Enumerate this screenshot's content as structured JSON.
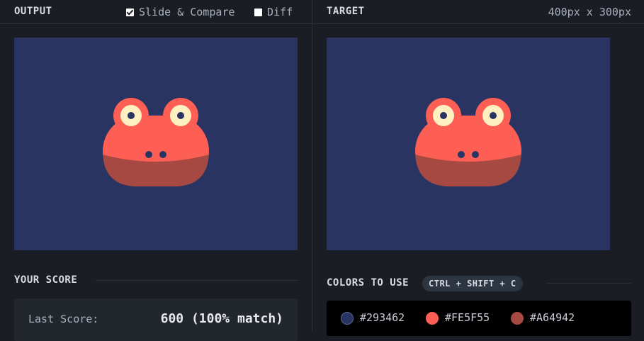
{
  "output": {
    "title": "OUTPUT",
    "slide_compare_label": "Slide & Compare",
    "slide_compare_checked": true,
    "diff_label": "Diff",
    "diff_checked": false
  },
  "target": {
    "title": "TARGET",
    "dimensions": "400px x 300px"
  },
  "score": {
    "section_title": "YOUR SCORE",
    "last_score_label": "Last Score:",
    "last_score_value": "600 (100% match)"
  },
  "colors": {
    "section_title": "COLORS TO USE",
    "shortcut": "CTRL + SHIFT + C",
    "swatches": [
      {
        "hex": "#293462",
        "label": "#293462"
      },
      {
        "hex": "#FE5F55",
        "label": "#FE5F55"
      },
      {
        "hex": "#A64942",
        "label": "#A64942"
      }
    ]
  },
  "art": {
    "background": "#293462",
    "head": "#FE5F55",
    "jaw": "#A64942",
    "eye_white": "#FFF0C2",
    "pupil": "#293462"
  }
}
